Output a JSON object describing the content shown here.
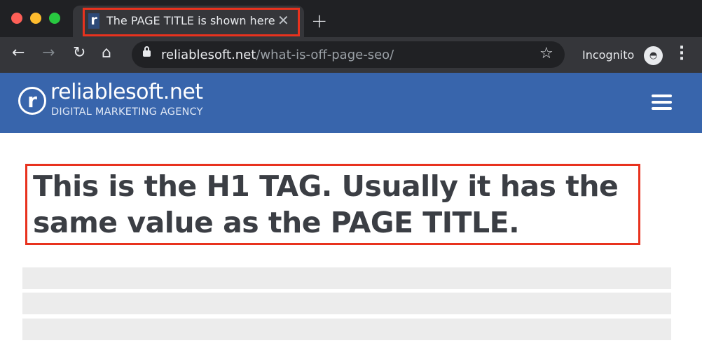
{
  "browser": {
    "tab_title": "The PAGE TITLE is shown here",
    "favicon_letter": "r",
    "url_domain": "reliablesoft.net",
    "url_path": "/what-is-off-page-seo/",
    "incognito_label": "Incognito",
    "icons": [
      "back-icon",
      "forward-icon",
      "reload-icon",
      "home-icon",
      "lock-icon",
      "star-icon",
      "incognito-icon",
      "menu-icon"
    ]
  },
  "site": {
    "logo_letter": "r",
    "brand": "reliablesoft.net",
    "tagline": "DIGITAL MARKETING AGENCY",
    "header_color": "#3865ac"
  },
  "main": {
    "h1": "This is the H1 TAG. Usually it has the same value as the PAGE TITLE.",
    "highlight_color": "#e8321e"
  }
}
